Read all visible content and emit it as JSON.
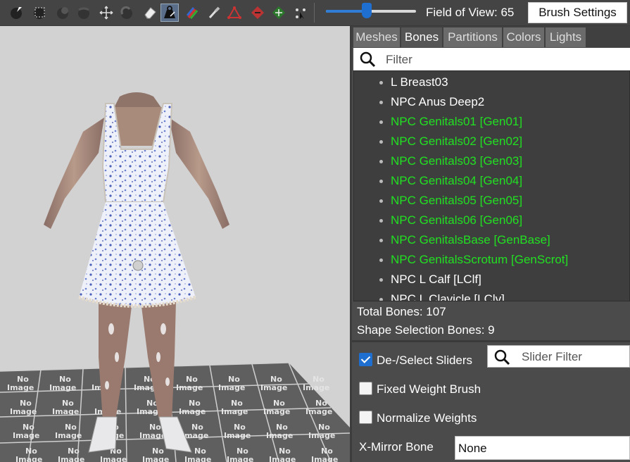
{
  "toolbar": {
    "tools": [
      {
        "name": "mask-brush-icon"
      },
      {
        "name": "inflate-brush-icon"
      },
      {
        "name": "deflate-brush-icon"
      },
      {
        "name": "move-brush-icon"
      },
      {
        "name": "smooth-brush-icon"
      },
      {
        "name": "undiff-brush-icon"
      },
      {
        "name": "eraser-brush-icon"
      },
      {
        "name": "weight-brush-icon",
        "active": true
      },
      {
        "name": "color-brush-icon"
      },
      {
        "name": "alpha-brush-icon"
      },
      {
        "name": "vertex-tool-icon"
      },
      {
        "name": "diamond-tool-icon"
      },
      {
        "name": "transform-tool-icon"
      },
      {
        "name": "select-tool-icon"
      }
    ],
    "fov_label": "Field of View: 65",
    "fov_value": 65,
    "fov_slider_fraction": 0.45,
    "brush_settings_label": "Brush Settings"
  },
  "tabs": [
    {
      "label": "Meshes"
    },
    {
      "label": "Bones",
      "selected": true
    },
    {
      "label": "Partitions"
    },
    {
      "label": "Colors"
    },
    {
      "label": "Lights"
    }
  ],
  "filter": {
    "placeholder": "Filter"
  },
  "bones": [
    {
      "label": "L Breast03",
      "highlight": false
    },
    {
      "label": "NPC Anus Deep2",
      "highlight": false
    },
    {
      "label": "NPC Genitals01 [Gen01]",
      "highlight": true
    },
    {
      "label": "NPC Genitals02 [Gen02]",
      "highlight": true
    },
    {
      "label": "NPC Genitals03 [Gen03]",
      "highlight": true
    },
    {
      "label": "NPC Genitals04 [Gen04]",
      "highlight": true
    },
    {
      "label": "NPC Genitals05 [Gen05]",
      "highlight": true
    },
    {
      "label": "NPC Genitals06 [Gen06]",
      "highlight": true
    },
    {
      "label": "NPC GenitalsBase [GenBase]",
      "highlight": true
    },
    {
      "label": "NPC GenitalsScrotum [GenScrot]",
      "highlight": true
    },
    {
      "label": "NPC L Calf [LClf]",
      "highlight": false
    },
    {
      "label": "NPC L Clavicle [LClv]",
      "highlight": false
    }
  ],
  "stats": {
    "total_bones": "Total Bones: 107",
    "shape_selection_bones": "Shape Selection Bones: 9"
  },
  "options": {
    "deselect_sliders": {
      "label": "De-/Select Sliders",
      "checked": true
    },
    "slider_filter_placeholder": "Slider Filter",
    "fixed_weight_brush": {
      "label": "Fixed Weight Brush",
      "checked": false
    },
    "normalize_weights": {
      "label": "Normalize Weights",
      "checked": false
    },
    "x_mirror_label": "X-Mirror Bone",
    "x_mirror_value": "None"
  },
  "viewport": {
    "floor_tile_text_line1": "No",
    "floor_tile_text_line2": "Image",
    "background_color": "#d2d2d2",
    "dress_color": "#eef0fa",
    "pattern_color": "#4a5fb8",
    "skin_color": "#b89a8a"
  }
}
